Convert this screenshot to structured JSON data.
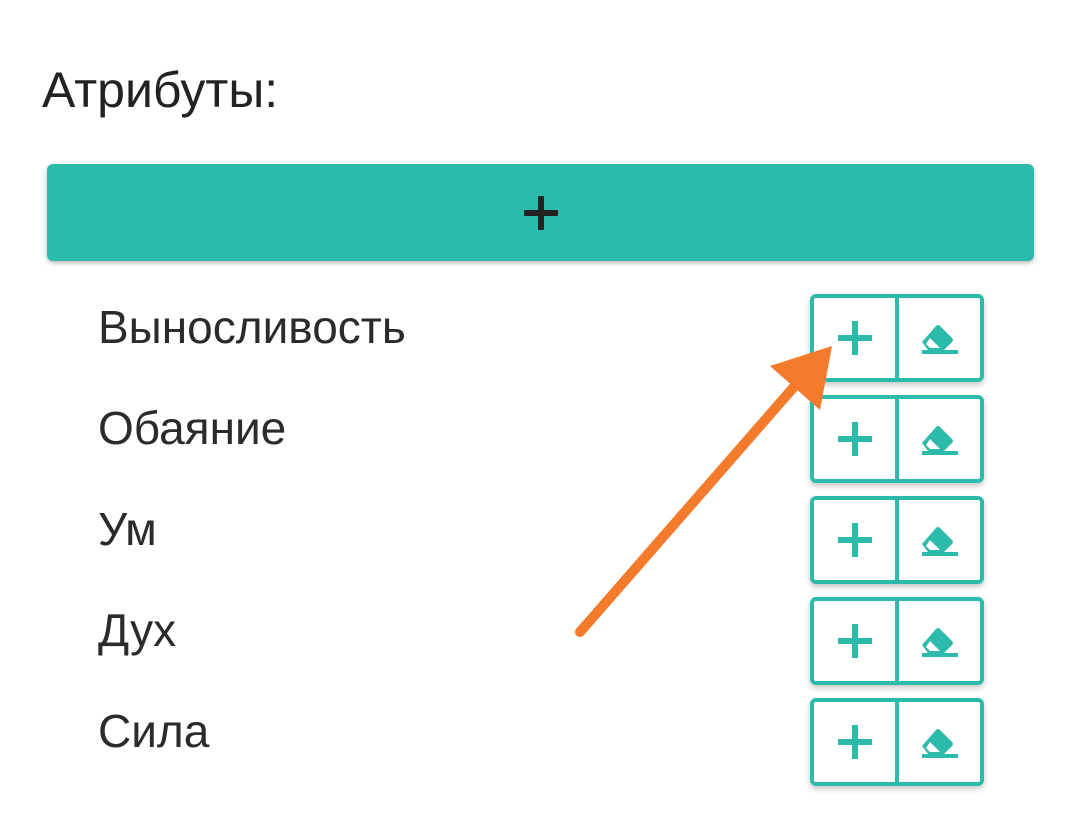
{
  "section": {
    "title": "Атрибуты:"
  },
  "add_button": {
    "icon": "plus-icon",
    "color": "#2cbbab"
  },
  "attributes": [
    {
      "name": "Выносливость"
    },
    {
      "name": "Обаяние"
    },
    {
      "name": "Ум"
    },
    {
      "name": "Дух"
    },
    {
      "name": "Сила"
    }
  ],
  "row_actions": {
    "increment_icon": "plus-icon",
    "erase_icon": "eraser-icon",
    "accent_color": "#2cbbab"
  },
  "annotation": {
    "type": "arrow",
    "color": "#f47a2c",
    "points_to": "increment-button-1"
  }
}
